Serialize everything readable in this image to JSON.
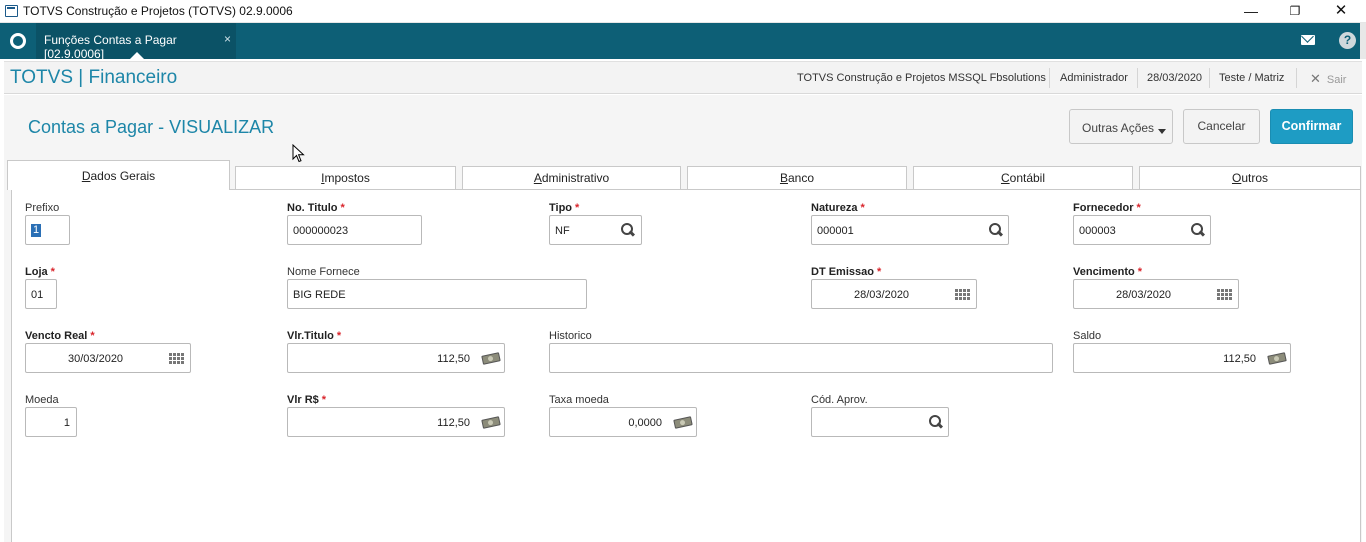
{
  "window": {
    "title": "TOTVS Construção e Projetos (TOTVS) 02.9.0006",
    "minimize": "—",
    "maximize": "❐",
    "close": "✕"
  },
  "tabbar": {
    "active_tab": "Funções Contas a Pagar [02.9.0006]",
    "close_glyph": "×",
    "help_glyph": "?"
  },
  "header": {
    "brand": "TOTVS | Financeiro",
    "company": "TOTVS Construção e Projetos MSSQL Fbsolutions",
    "user": "Administrador",
    "date": "28/03/2020",
    "branch": "Teste / Matriz",
    "logout": "Sair",
    "logout_glyph": "✕"
  },
  "page": {
    "title": "Contas a Pagar - VISUALIZAR",
    "buttons": {
      "more_actions": "Outras Ações",
      "cancel": "Cancelar",
      "confirm": "Confirmar"
    }
  },
  "tabs": [
    {
      "label": "Dados Gerais",
      "underline": "D",
      "rest": "ados Gerais"
    },
    {
      "label": "Impostos",
      "underline": "I",
      "rest": "mpostos"
    },
    {
      "label": "Administrativo",
      "underline": "A",
      "rest": "dministrativo"
    },
    {
      "label": "Banco",
      "underline": "B",
      "rest": "anco"
    },
    {
      "label": "Contábil",
      "underline": "C",
      "rest": "ontábil"
    },
    {
      "label": "Outros",
      "underline": "O",
      "rest": "utros"
    }
  ],
  "form": {
    "prefixo": {
      "label": "Prefixo",
      "value": "1"
    },
    "no_titulo": {
      "label": "No. Titulo",
      "value": "000000023"
    },
    "tipo": {
      "label": "Tipo",
      "value": "NF"
    },
    "natureza": {
      "label": "Natureza",
      "value": "000001"
    },
    "fornecedor": {
      "label": "Fornecedor",
      "value": "000003"
    },
    "loja": {
      "label": "Loja",
      "value": "01"
    },
    "nome_fornece": {
      "label": "Nome Fornece",
      "value": "BIG REDE"
    },
    "dt_emissao": {
      "label": "DT Emissao",
      "value": "28/03/2020"
    },
    "vencimento": {
      "label": "Vencimento",
      "value": "28/03/2020"
    },
    "vencto_real": {
      "label": "Vencto Real",
      "value": "30/03/2020"
    },
    "vlr_titulo": {
      "label": "Vlr.Titulo",
      "value": "112,50"
    },
    "historico": {
      "label": "Historico",
      "value": ""
    },
    "saldo": {
      "label": "Saldo",
      "value": "112,50"
    },
    "moeda": {
      "label": "Moeda",
      "value": "1"
    },
    "vlr_rs": {
      "label": "Vlr R$",
      "value": "112,50"
    },
    "taxa_moeda": {
      "label": "Taxa moeda",
      "value": "0,0000"
    },
    "cod_aprov": {
      "label": "Cód. Aprov.",
      "value": ""
    },
    "required_mark": "*"
  },
  "colors": {
    "tabbar_bg": "#0d5f76",
    "accent": "#1d86a8",
    "confirm_bg": "#1e9cc4",
    "required": "#d9242b"
  }
}
